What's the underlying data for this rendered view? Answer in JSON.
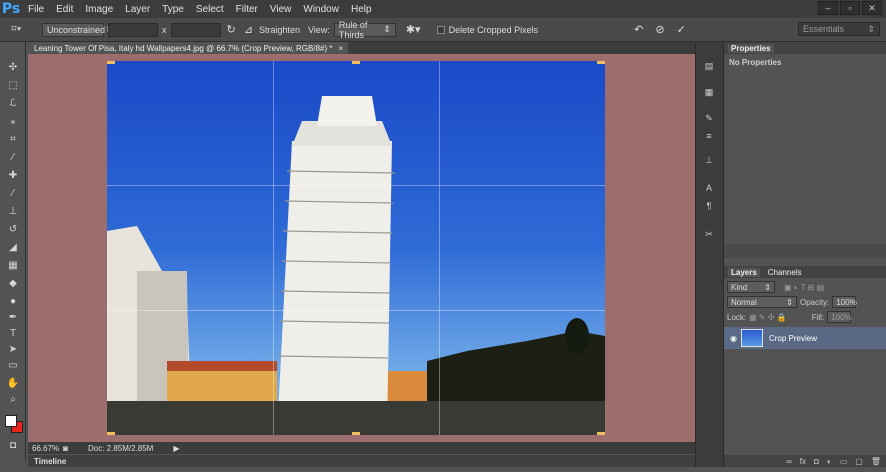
{
  "app": {
    "logo": "Ps"
  },
  "menu": [
    "File",
    "Edit",
    "Image",
    "Layer",
    "Type",
    "Select",
    "Filter",
    "View",
    "Window",
    "Help"
  ],
  "window_controls": [
    "–",
    "▫",
    "✕"
  ],
  "options_bar": {
    "ratio_select": "Unconstrained",
    "swap_label": "x",
    "straighten_label": "Straighten",
    "view_label": "View:",
    "view_select": "Rule of Thirds",
    "delete_cropped_label": "Delete Cropped Pixels",
    "workspace_select": "Essentials"
  },
  "document": {
    "tab_title": "Leaning Tower Of Pisa, Italy hd Wallpapers4.jpg @ 66.7% (Crop Preview, RGB/8#) *",
    "close_glyph": "×",
    "zoom": "66.67%",
    "doc_size": "Doc: 2.85M/2.85M"
  },
  "timeline": {
    "label": "Timeline"
  },
  "properties_panel": {
    "title": "Properties",
    "empty_text": "No Properties"
  },
  "layers_panel": {
    "tabs": [
      "Layers",
      "Channels"
    ],
    "filter_select": "Kind",
    "blend_select": "Normal",
    "opacity_label": "Opacity:",
    "opacity_value": "100%",
    "lock_label": "Lock:",
    "fill_label": "Fill:",
    "fill_value": "100%",
    "layer_name": "Crop Preview"
  },
  "colors": {
    "foreground": "#ffffff",
    "background": "#e8241c",
    "canvas_bg": "#9b6d6d"
  }
}
